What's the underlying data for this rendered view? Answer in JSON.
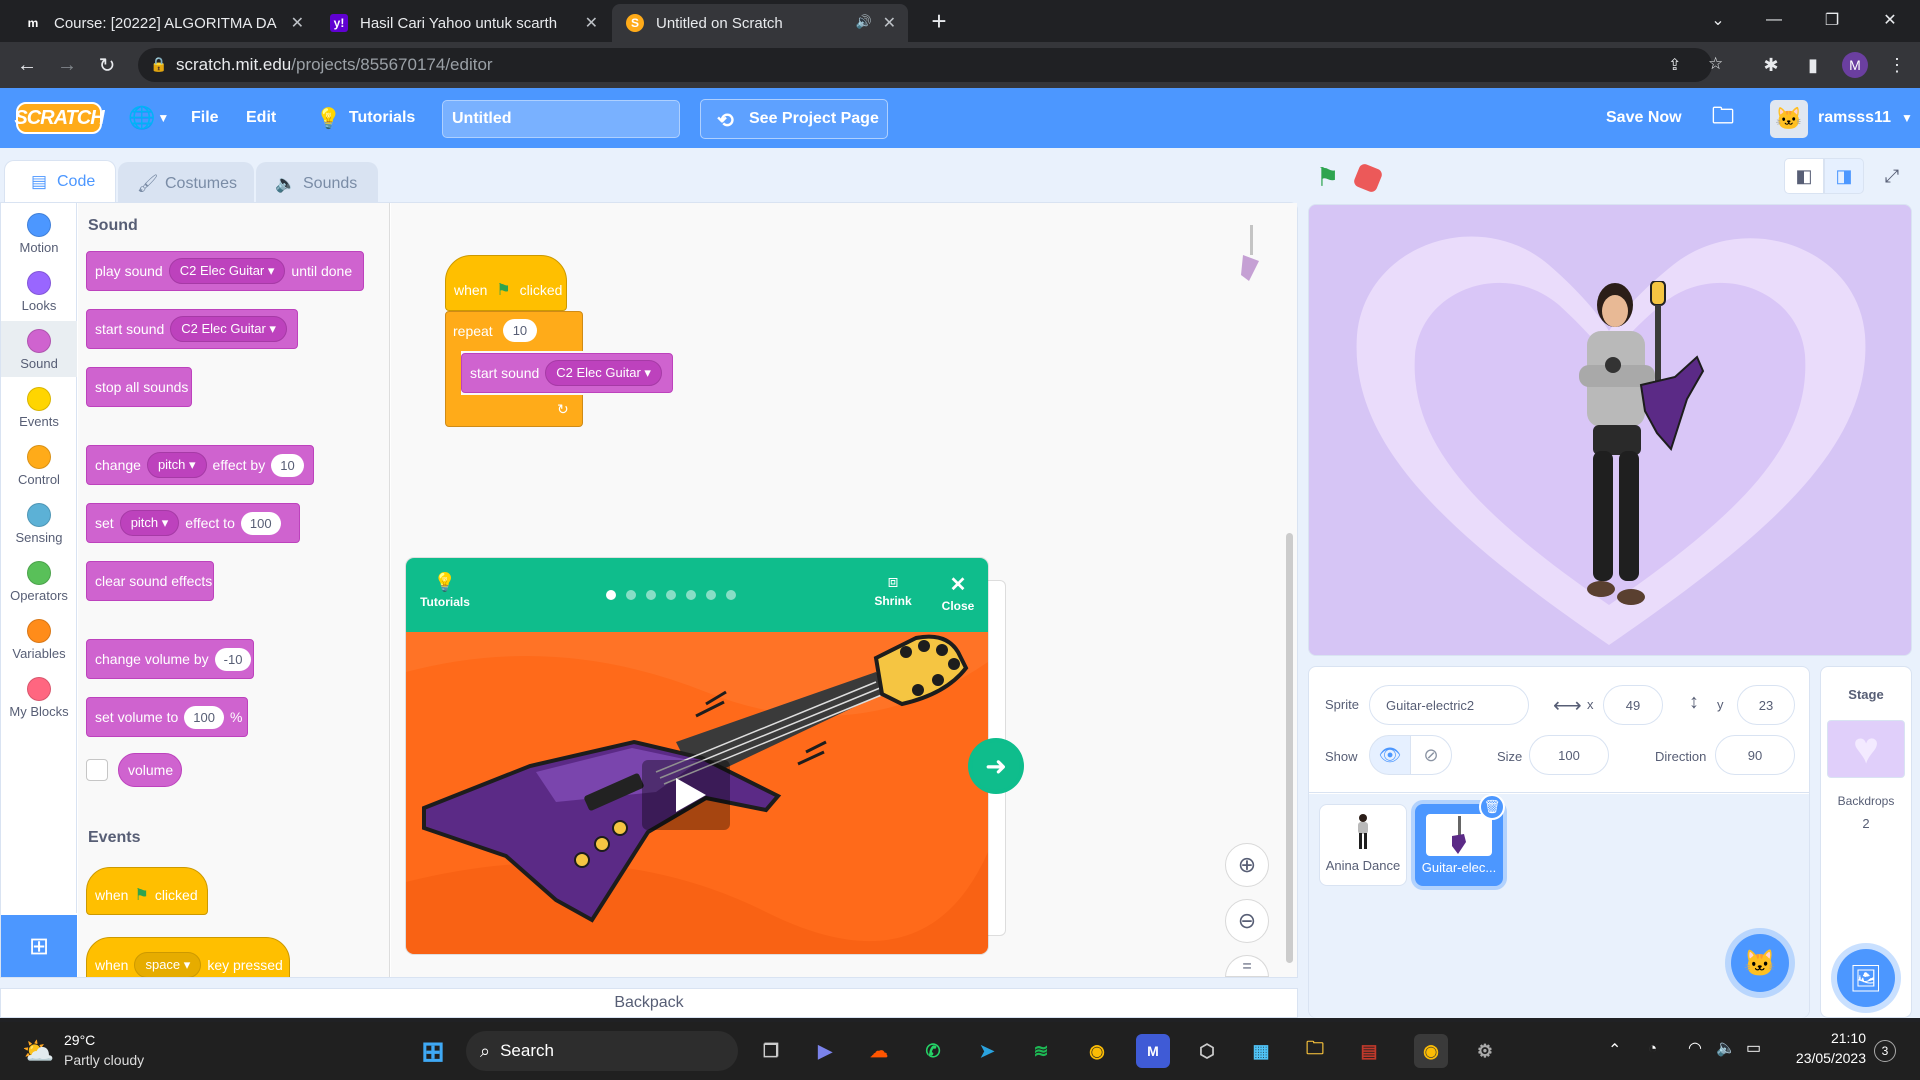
{
  "browser": {
    "tabs": [
      {
        "title": "Course: [20222] ALGORITMA DA",
        "icon": "moodle-icon"
      },
      {
        "title": "Hasil Cari Yahoo untuk scarth",
        "icon": "yahoo-icon"
      },
      {
        "title": "Untitled on Scratch",
        "icon": "scratch-icon",
        "active": true
      }
    ],
    "url_host": "scratch.mit.edu",
    "url_path": "/projects/855670174/editor",
    "profile_initial": "M"
  },
  "menubar": {
    "logo": "SCRATCH",
    "file": "File",
    "edit": "Edit",
    "tutorials": "Tutorials",
    "project_title": "Untitled",
    "see_project": "See Project Page",
    "save_now": "Save Now",
    "username": "ramsss11"
  },
  "editor_tabs": {
    "code": "Code",
    "costumes": "Costumes",
    "sounds": "Sounds"
  },
  "categories": [
    {
      "label": "Motion",
      "color": "#4c97ff"
    },
    {
      "label": "Looks",
      "color": "#9966ff"
    },
    {
      "label": "Sound",
      "color": "#cf63cf"
    },
    {
      "label": "Events",
      "color": "#ffd500"
    },
    {
      "label": "Control",
      "color": "#ffab19"
    },
    {
      "label": "Sensing",
      "color": "#5cb1d6"
    },
    {
      "label": "Operators",
      "color": "#59c059"
    },
    {
      "label": "Variables",
      "color": "#ff8c1a"
    },
    {
      "label": "My Blocks",
      "color": "#ff6680"
    }
  ],
  "palette": {
    "sound_heading": "Sound",
    "play_sound": "play sound",
    "until_done": "until done",
    "start_sound": "start sound",
    "sound_name": "C2 Elec Guitar",
    "stop_all": "stop all sounds",
    "change": "change",
    "pitch": "pitch",
    "effect_by": "effect by",
    "change_val": "10",
    "set": "set",
    "effect_to": "effect to",
    "set_val": "100",
    "clear_effects": "clear sound effects",
    "change_volume_by": "change volume by",
    "volume_delta": "-10",
    "set_volume_to": "set volume to",
    "volume_val": "100",
    "percent": "%",
    "volume": "volume",
    "events_heading": "Events",
    "when": "when",
    "clicked": "clicked",
    "space": "space",
    "key_pressed": "key pressed"
  },
  "script": {
    "when": "when",
    "clicked": "clicked",
    "repeat": "repeat",
    "repeat_count": "10",
    "start_sound": "start sound",
    "sound_name": "C2 Elec Guitar"
  },
  "tutorial": {
    "label": "Tutorials",
    "shrink": "Shrink",
    "close": "Close",
    "dots": 7,
    "current_dot": 1
  },
  "backpack": "Backpack",
  "sprite": {
    "label_sprite": "Sprite",
    "name": "Guitar-electric2",
    "x_label": "x",
    "x": "49",
    "y_label": "y",
    "y": "23",
    "show_label": "Show",
    "size_label": "Size",
    "size": "100",
    "direction_label": "Direction",
    "direction": "90"
  },
  "sprites": [
    {
      "name": "Anina Dance",
      "selected": false
    },
    {
      "name": "Guitar-elec...",
      "selected": true
    }
  ],
  "stage_panel": {
    "title": "Stage",
    "backdrops_label": "Backdrops",
    "backdrops_count": "2"
  },
  "taskbar": {
    "weather_temp": "29°C",
    "weather_desc": "Partly cloudy",
    "search": "Search",
    "time": "21:10",
    "date": "23/05/2023",
    "notif_count": "3"
  }
}
